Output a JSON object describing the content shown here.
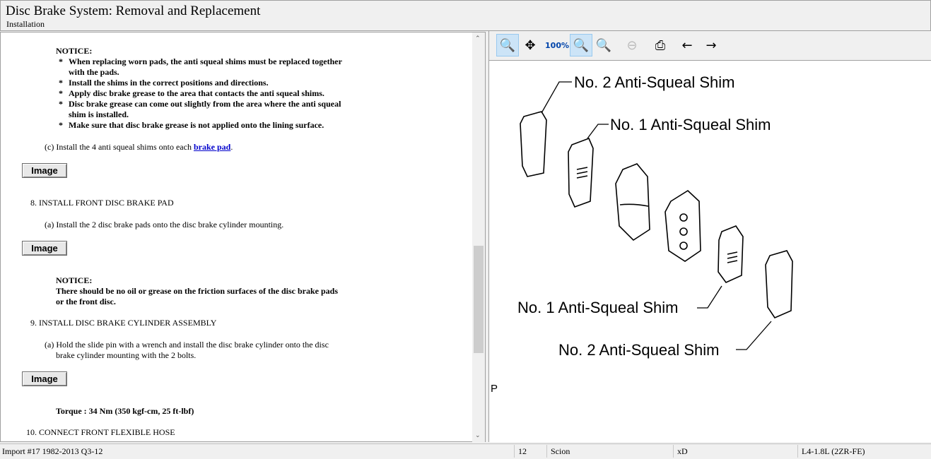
{
  "header": {
    "title": "Disc Brake System:  Removal and Replacement",
    "subtitle": "Installation"
  },
  "content": {
    "notice1_title": "NOTICE:",
    "notice1_items": [
      [
        "When replacing worn pads, the anti squeal shims must be replaced together",
        "with the pads."
      ],
      [
        "Install the shims in the correct positions and directions."
      ],
      [
        "Apply disc brake grease to the area that contacts the anti squeal shims."
      ],
      [
        "Disc brake grease can come out slightly from the area where the anti squeal",
        "shim is installed."
      ],
      [
        "Make sure that disc brake grease is not applied onto the lining surface."
      ]
    ],
    "bullet": "*",
    "step_c": "(c) Install the 4 anti squeal shims onto each ",
    "step_c_link": "brake pad",
    "step_c_end": ".",
    "image_button": "Image",
    "step8": "8.   INSTALL FRONT DISC BRAKE PAD",
    "step8a": "(a) Install the 2 disc brake pads onto the disc brake cylinder mounting.",
    "notice2_title": "NOTICE:",
    "notice2_lines": [
      "There should be no oil or grease on the friction surfaces of the disc brake pads",
      "or the front disc."
    ],
    "step9": "9.   INSTALL DISC BRAKE CYLINDER ASSEMBLY",
    "step9a": [
      "(a) Hold the slide pin with a wrench and install the disc brake cylinder onto the disc",
      "brake cylinder mounting with the 2 bolts."
    ],
    "torque": "Torque : 34 Nm (350 kgf-cm, 25 ft-lbf)",
    "step10": "10.   CONNECT FRONT FLEXIBLE HOSE"
  },
  "toolbar": [
    {
      "icon": "zoom-in-icon",
      "active": true
    },
    {
      "icon": "pan-icon"
    },
    {
      "icon": "zoom-100-icon",
      "label": "100%"
    },
    {
      "icon": "zoom-fit-icon",
      "active": true
    },
    {
      "icon": "zoom-width-icon"
    },
    {
      "icon": "zoom-out-icon",
      "disabled": true
    },
    {
      "icon": "print-icon"
    },
    {
      "icon": "previous-image-icon"
    },
    {
      "icon": "next-image-icon"
    }
  ],
  "diagram": {
    "labels": [
      "No. 2 Anti-Squeal Shim",
      "No. 1 Anti-Squeal Shim",
      "No. 1 Anti-Squeal Shim",
      "No. 2 Anti-Squeal Shim"
    ],
    "corner": "P"
  },
  "status": {
    "import": "Import #17 1982-2013 Q3-12",
    "num": "12",
    "make": "Scion",
    "model": "xD",
    "engine": "L4-1.8L (2ZR-FE)"
  }
}
